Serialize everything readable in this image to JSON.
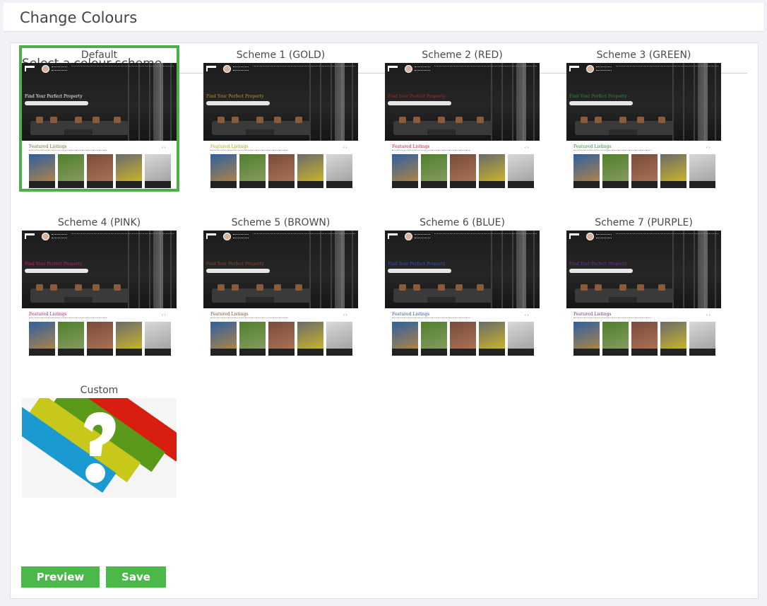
{
  "page": {
    "title": "Change Colours"
  },
  "section": {
    "title": "Select a colour scheme"
  },
  "thumbnail": {
    "headline": "Find Your Perfect Property",
    "featured_heading": "Featured Listings",
    "arrows": "‹  ›"
  },
  "schemes": [
    {
      "label": "Default",
      "accent": "#7a6a3a",
      "selected": true
    },
    {
      "label": "Scheme 1 (GOLD)",
      "accent": "#b89a2a",
      "selected": false
    },
    {
      "label": "Scheme 2 (RED)",
      "accent": "#b3262a",
      "selected": false
    },
    {
      "label": "Scheme 3 (GREEN)",
      "accent": "#2e8a3a",
      "selected": false
    },
    {
      "label": "Scheme 4 (PINK)",
      "accent": "#c2207a",
      "selected": false
    },
    {
      "label": "Scheme 5 (BROWN)",
      "accent": "#8a4a2a",
      "selected": false
    },
    {
      "label": "Scheme 6 (BLUE)",
      "accent": "#2a5ab8",
      "selected": false
    },
    {
      "label": "Scheme 7 (PURPLE)",
      "accent": "#7a2a9a",
      "selected": false
    },
    {
      "label": "Custom",
      "accent": "#e62020",
      "selected": false
    }
  ],
  "buttons": {
    "preview": "Preview",
    "save": "Save"
  },
  "colors": {
    "selected_border": "#4cb04a",
    "button": "#4cb84a"
  }
}
